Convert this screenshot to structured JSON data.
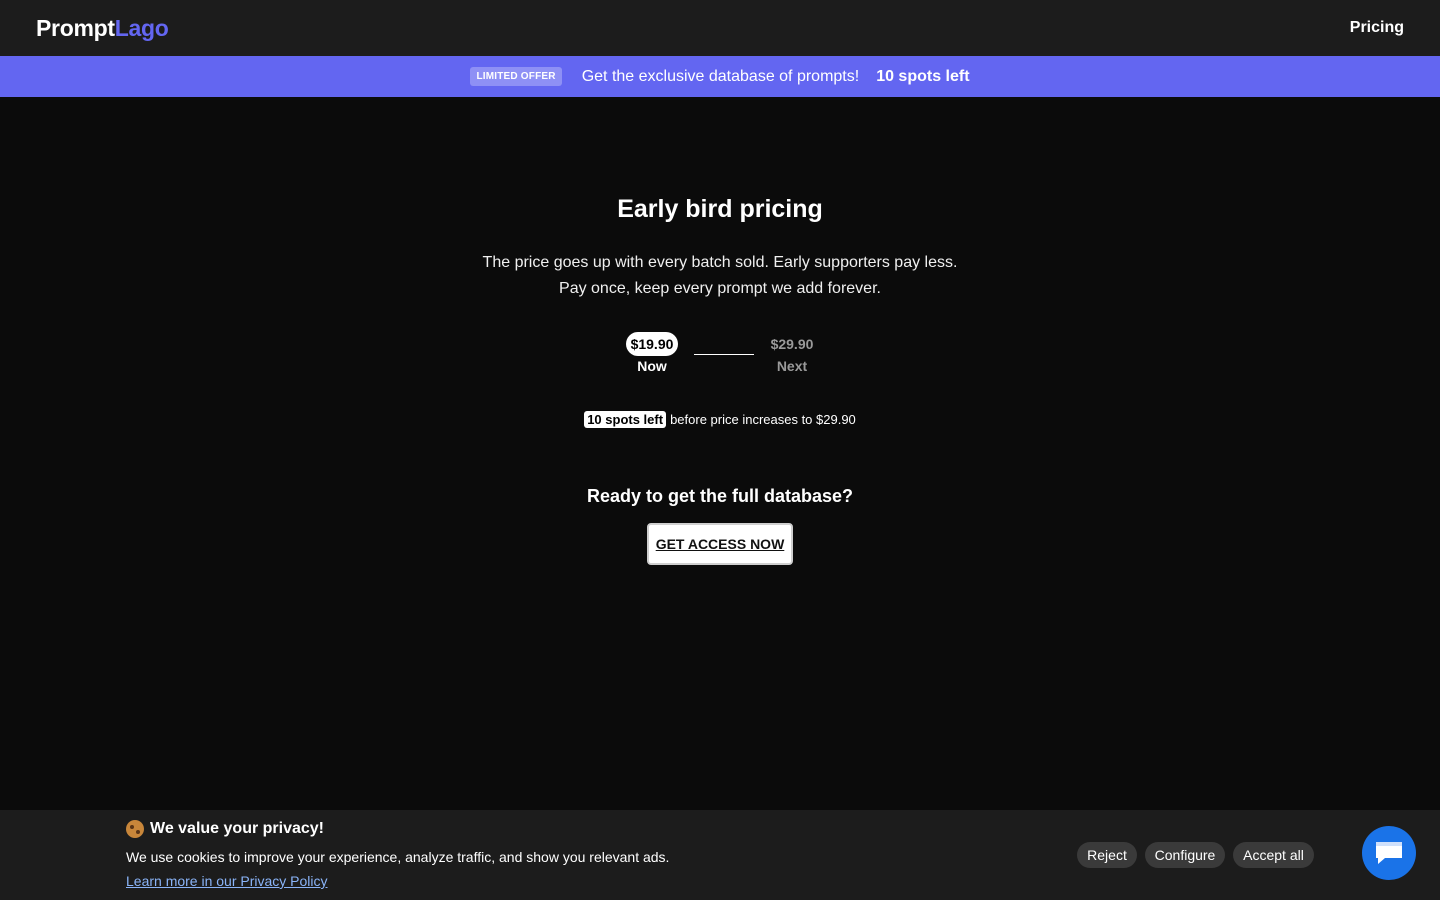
{
  "header": {
    "logo_part1": "Prompt",
    "logo_part2": "Lago",
    "nav_pricing": "Pricing"
  },
  "offer_bar": {
    "badge": "LIMITED OFFER",
    "text": "Get the exclusive database of prompts!",
    "spots": "10 spots left"
  },
  "main": {
    "title": "Early bird pricing",
    "subtitle_line1": "The price goes up with every batch sold. Early supporters pay less.",
    "subtitle_line2": "Pay once, keep every prompt we add forever.",
    "price_now": "$19.90",
    "price_now_label": "Now",
    "price_next": "$29.90",
    "price_next_label": "Next",
    "spots_pill": "10 spots left",
    "spots_text": "before price increases to $29.90",
    "cta_heading": "Ready to get the full database?",
    "cta_button": "GET ACCESS NOW"
  },
  "cookie_banner": {
    "title": "We value your privacy!",
    "text": "We use cookies to improve your experience, analyze traffic, and show you relevant ads.",
    "link": "Learn more in our Privacy Policy",
    "reject": "Reject",
    "configure": "Configure",
    "accept": "Accept all"
  },
  "colors": {
    "brand": "#6366f1",
    "background": "#0b0b0b",
    "header_bg": "#1c1c1c",
    "chat_button": "#1a73e8"
  },
  "icons": {
    "cookie": "cookie-icon",
    "chat": "chat-icon"
  }
}
